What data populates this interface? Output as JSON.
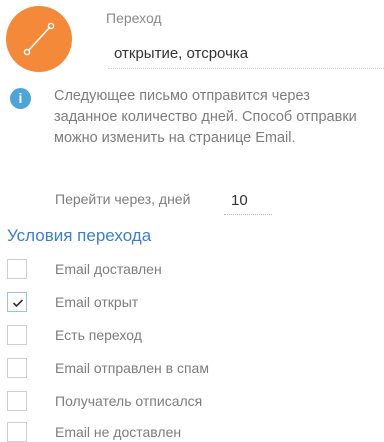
{
  "header": {
    "transition_label": "Переход",
    "transition_name": "открытие, отсрочка"
  },
  "info": {
    "text": "Следующее письмо отправится через заданное количество дней. Способ отправки можно изменить на странице Email."
  },
  "delay": {
    "label": "Перейти через, дней",
    "value": "10"
  },
  "conditions": {
    "title": "Условия перехода",
    "items": [
      {
        "label": "Email доставлен",
        "checked": false
      },
      {
        "label": "Email открыт",
        "checked": true
      },
      {
        "label": "Есть переход",
        "checked": false
      },
      {
        "label": "Email отправлен в спам",
        "checked": false
      },
      {
        "label": "Получатель отписался",
        "checked": false
      },
      {
        "label": "Email не доставлен",
        "checked": false
      }
    ]
  },
  "colors": {
    "accent_orange": "#f5893a",
    "info_blue": "#4ca4d8",
    "title_blue": "#3b7fd0"
  },
  "icons": {
    "transition": "connector-line-icon",
    "info": "info-icon",
    "check": "checkmark-icon"
  }
}
